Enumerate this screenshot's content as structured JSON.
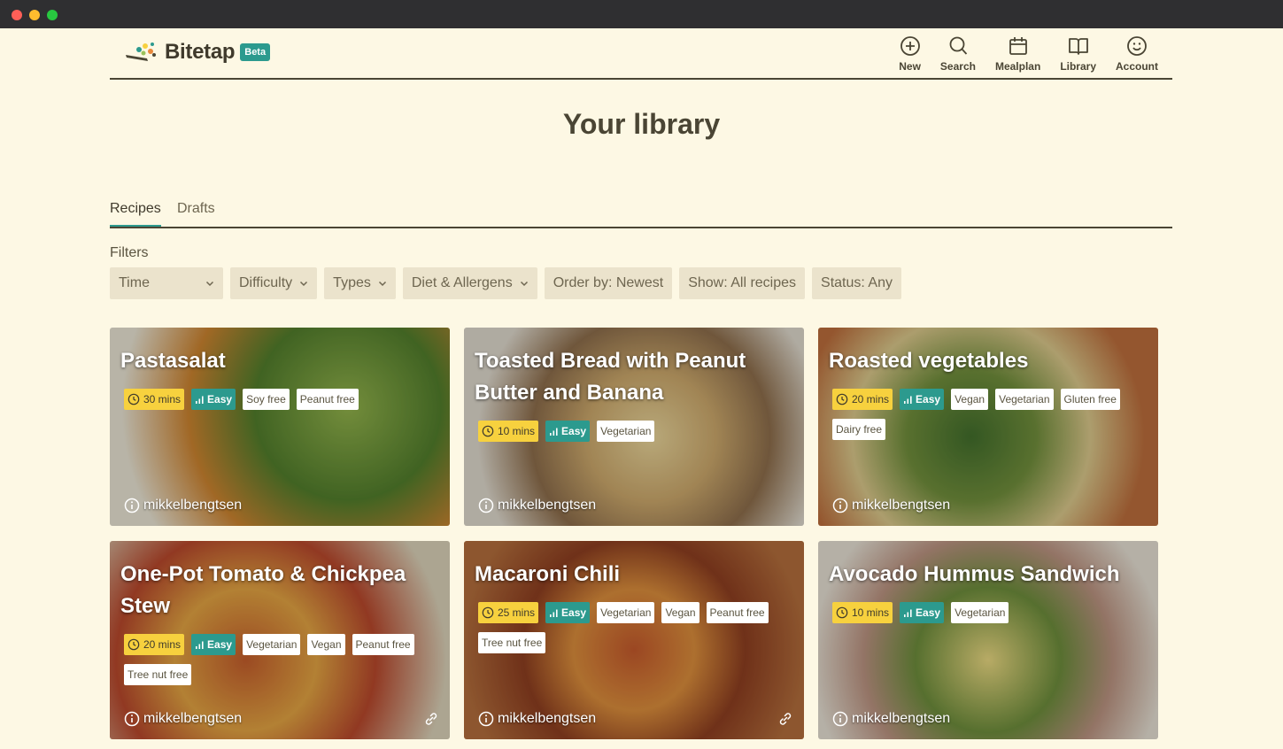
{
  "app": {
    "name": "Bitetap",
    "badge": "Beta"
  },
  "nav": [
    {
      "label": "New",
      "icon": "plus-circle-icon"
    },
    {
      "label": "Search",
      "icon": "search-icon"
    },
    {
      "label": "Mealplan",
      "icon": "calendar-icon"
    },
    {
      "label": "Library",
      "icon": "book-icon"
    },
    {
      "label": "Account",
      "icon": "smiley-icon"
    }
  ],
  "page_title": "Your library",
  "tabs": [
    "Recipes",
    "Drafts"
  ],
  "filters_label": "Filters",
  "filters": [
    "Time",
    "Difficulty",
    "Types",
    "Diet & Allergens",
    "Order by: Newest",
    "Show: All recipes",
    "Status: Any"
  ],
  "recipes": [
    {
      "title": "Pastasalat",
      "time": "30 mins",
      "difficulty": "Easy",
      "tags": [
        "Soy free",
        "Peanut free"
      ],
      "author": "mikkelbengtsen",
      "has_link": false
    },
    {
      "title": "Toasted Bread with Peanut Butter and Banana",
      "time": "10 mins",
      "difficulty": "Easy",
      "tags": [
        "Vegetarian"
      ],
      "author": "mikkelbengtsen",
      "has_link": false
    },
    {
      "title": "Roasted vegetables",
      "time": "20 mins",
      "difficulty": "Easy",
      "tags": [
        "Vegan",
        "Vegetarian",
        "Gluten free",
        "Dairy free"
      ],
      "author": "mikkelbengtsen",
      "has_link": false
    },
    {
      "title": "One-Pot Tomato & Chickpea Stew",
      "time": "20 mins",
      "difficulty": "Easy",
      "tags": [
        "Vegetarian",
        "Vegan",
        "Peanut free",
        "Tree nut free"
      ],
      "author": "mikkelbengtsen",
      "has_link": true
    },
    {
      "title": "Macaroni Chili",
      "time": "25 mins",
      "difficulty": "Easy",
      "tags": [
        "Vegetarian",
        "Vegan",
        "Peanut free",
        "Tree nut free"
      ],
      "author": "mikkelbengtsen",
      "has_link": true
    },
    {
      "title": "Avocado Hummus Sandwich",
      "time": "10 mins",
      "difficulty": "Easy",
      "tags": [
        "Vegetarian"
      ],
      "author": "mikkelbengtsen",
      "has_link": false
    }
  ],
  "colors": {
    "background": "#fdf8e4",
    "accent": "#2c9a8e",
    "time_badge": "#f7d13e",
    "titlebar": "#2f2f31"
  }
}
